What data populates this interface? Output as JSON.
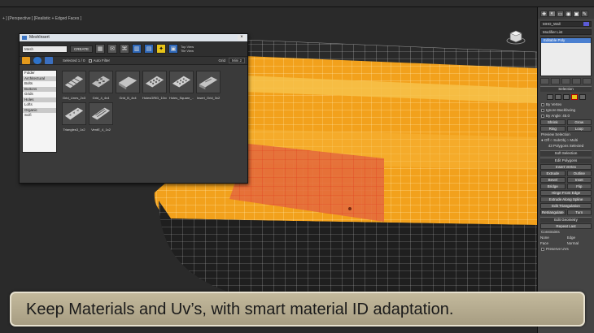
{
  "viewport": {
    "label": "+ ] [Perspective ] [Realistic + Edged Faces ]"
  },
  "window": {
    "title": "MeshInsert",
    "close_glyph": "×",
    "name_value": "Mesh",
    "create_label": "CREATE",
    "side_labels": [
      "Top View",
      "Tile View"
    ],
    "selected_label": "Selected 1 / 0",
    "auto_filter_label": "Auto Filter",
    "grid_label": "Grid",
    "size_value": "Mini 2"
  },
  "folders": [
    "Folder",
    "Architectural",
    "Bolts",
    "Buttons",
    "Grids",
    "Holes",
    "Lofts",
    "Organic",
    "Scifi"
  ],
  "thumbnails": [
    {
      "label": "Grid_Lines_2x3"
    },
    {
      "label": "Grid_4_4x4"
    },
    {
      "label": "Grid_B_4x4"
    },
    {
      "label": "HolesGRID_10x4"
    },
    {
      "label": "Holes_Square_..."
    },
    {
      "label": "Insert_Grid_3x2"
    },
    {
      "label": "Triangles3_1x2"
    },
    {
      "label": "VentE_4_1x2"
    }
  ],
  "command_panel": {
    "tab_icons": [
      "✚",
      "◐",
      "▭",
      "◉",
      "▣",
      "✎"
    ],
    "object_name": "MHO_Wall",
    "modifier_list": "Modifier List",
    "stack_item": "Editable Poly",
    "selection_title": "Selection",
    "by_vertex": "By Vertex",
    "ignore_backfacing": "Ignore Backfacing",
    "by_angle": "By Angle:",
    "by_angle_value": "45.0",
    "shrink": "Shrink",
    "grow": "Grow",
    "ring": "Ring",
    "loop": "Loop",
    "preview_selection": "Preview Selection",
    "preview_opts": "● Off  ○ SubObj  ○ Multi",
    "selected_info": "43 Polygons Selected",
    "soft_selection": "Soft Selection",
    "edit_polygons": "Edit Polygons",
    "insert_vertex": "Insert Vertex",
    "extrude": "Extrude",
    "outline": "Outline",
    "bevel": "Bevel",
    "inset": "Inset",
    "bridge": "Bridge",
    "flip": "Flip",
    "hinge_from_edge": "Hinge From Edge",
    "extrude_along_spline": "Extrude Along Spline",
    "edit_triangulation": "Edit Triangulation",
    "retriangulate": "Retriangulate",
    "turn": "Turn",
    "edit_geometry": "Edit Geometry",
    "repeat_last": "Repeat Last",
    "constraints": "Constraints",
    "none": "None",
    "edge": "Edge",
    "face": "Face",
    "normal": "Normal",
    "preserve_uvs": "Preserve UVs"
  },
  "caption": "Keep Materials and Uv’s, with smart material ID adaptation."
}
